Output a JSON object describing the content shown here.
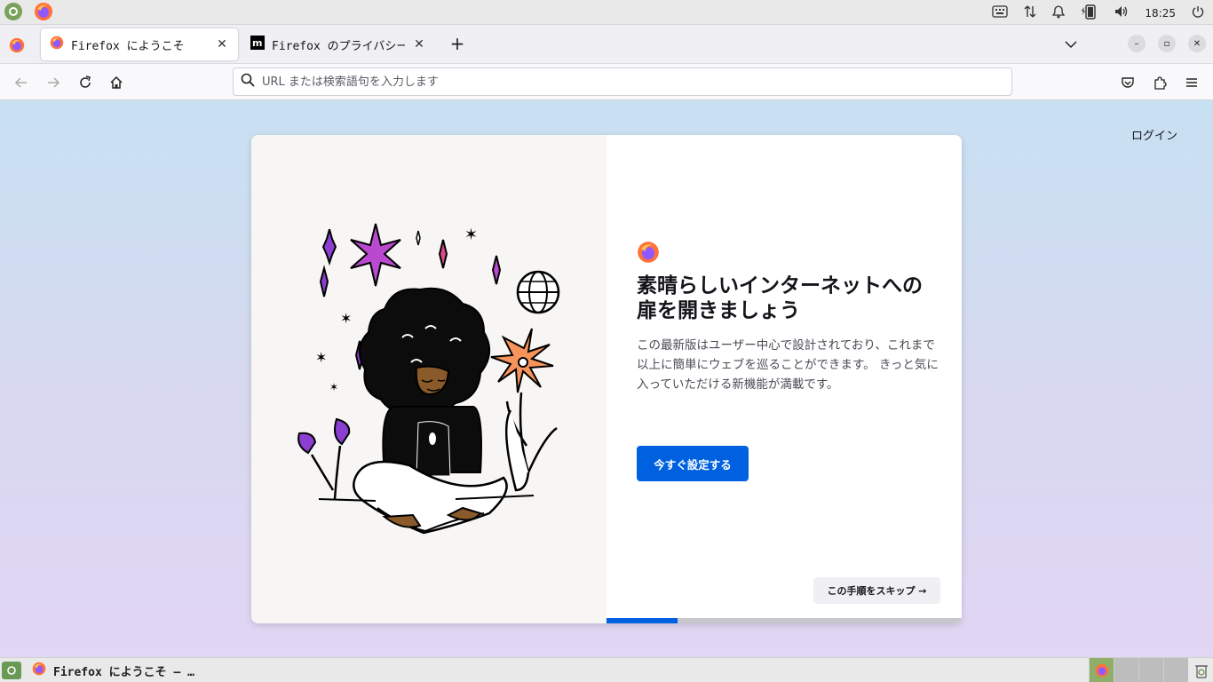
{
  "system_panel": {
    "clock": "18:25"
  },
  "tabs": [
    {
      "title": "Firefox にようこそ",
      "active": true
    },
    {
      "title": "Firefox のプライバシーに関",
      "active": false
    }
  ],
  "urlbar": {
    "placeholder": "URL または検索語句を入力します"
  },
  "page": {
    "login_label": "ログイン",
    "title": "素晴らしいインターネットへの扉を開きましょう",
    "body": "この最新版はユーザー中心で設計されており、これまで以上に簡単にウェブを巡ることができます。 きっと気に入っていただける新機能が満載です。",
    "primary_button": "今すぐ設定する",
    "skip_button": "この手順をスキップ →",
    "progress_fraction": 0.2,
    "accent_color": "#0061e0"
  },
  "taskbar": {
    "window_title": "Firefox にようこそ — …"
  },
  "icons": [
    "system-menu-icon",
    "firefox-icon",
    "keyboard-icon",
    "network-icon",
    "bell-icon",
    "battery-icon",
    "volume-icon",
    "power-icon",
    "back-icon",
    "forward-icon",
    "reload-icon",
    "home-icon",
    "search-icon",
    "pocket-icon",
    "extensions-icon",
    "menu-icon",
    "close-icon",
    "plus-icon",
    "chevron-down-icon",
    "trash-icon"
  ]
}
